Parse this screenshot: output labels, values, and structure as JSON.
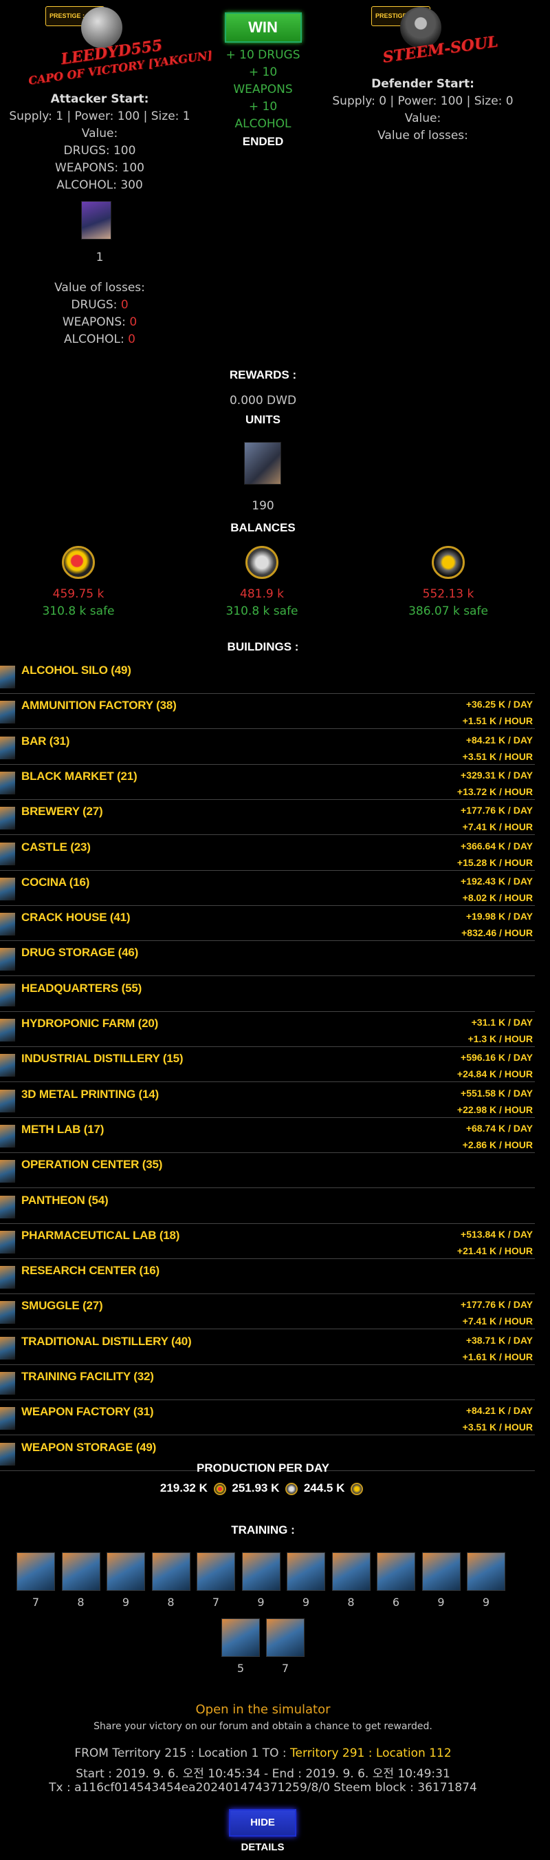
{
  "attacker": {
    "prestige": "PRESTIGE : 1000",
    "name": "LEEDYD555",
    "title": "CAPO OF VICTORY [YAKGUN]",
    "start_heading": "Attacker Start:",
    "stats": "Supply: 1 | Power: 100 | Size: 1",
    "value_label": "Value:",
    "drugs": "DRUGS: 100",
    "weapons": "WEAPONS: 100",
    "alcohol": "ALCOHOL: 300",
    "unit_count": "1",
    "losses_label": "Value of losses:",
    "loss_drugs_label": "DRUGS: ",
    "loss_drugs": "0",
    "loss_weapons_label": "WEAPONS: ",
    "loss_weapons": "0",
    "loss_alcohol_label": "ALCOHOL: ",
    "loss_alcohol": "0"
  },
  "result": {
    "win_label": "WIN",
    "gain_drugs": "+ 10 DRUGS",
    "gain_weapons_1": "+ 10",
    "gain_weapons_2": "WEAPONS",
    "gain_alcohol_1": "+ 10",
    "gain_alcohol_2": "ALCOHOL",
    "status": "ENDED"
  },
  "defender": {
    "prestige": "PRESTIGE : 1000",
    "name": "STEEM-SOUL",
    "start_heading": "Defender Start:",
    "stats": "Supply: 0 | Power: 100 | Size: 0",
    "value_label": "Value:",
    "losses_label": "Value of losses:"
  },
  "rewards": {
    "title": "REWARDS :",
    "amount": "0.000 DWD",
    "units_title": "UNITS",
    "unit_count": "190"
  },
  "balances": {
    "title": "BALANCES",
    "items": [
      {
        "icon": "drugs-icon",
        "value": "459.75 k",
        "safe": "310.8 k safe"
      },
      {
        "icon": "weapons-icon",
        "value": "481.9 k",
        "safe": "310.8 k safe"
      },
      {
        "icon": "alcohol-icon",
        "value": "552.13 k",
        "safe": "386.07 k safe"
      }
    ]
  },
  "buildings": {
    "title": "BUILDINGS :",
    "rows": [
      {
        "name": "ALCOHOL SILO (49)",
        "day": "",
        "hour": ""
      },
      {
        "name": "AMMUNITION FACTORY (38)",
        "day": "+36.25 K / DAY",
        "hour": "+1.51 K / HOUR"
      },
      {
        "name": "BAR (31)",
        "day": "+84.21 K / DAY",
        "hour": "+3.51 K / HOUR"
      },
      {
        "name": "BLACK MARKET (21)",
        "day": "+329.31 K / DAY",
        "hour": "+13.72 K / HOUR"
      },
      {
        "name": "BREWERY (27)",
        "day": "+177.76 K / DAY",
        "hour": "+7.41 K / HOUR"
      },
      {
        "name": "CASTLE (23)",
        "day": "+366.64 K / DAY",
        "hour": "+15.28 K / HOUR"
      },
      {
        "name": "COCINA (16)",
        "day": "+192.43 K / DAY",
        "hour": "+8.02 K / HOUR"
      },
      {
        "name": "CRACK HOUSE (41)",
        "day": "+19.98 K / DAY",
        "hour": "+832.46 / HOUR"
      },
      {
        "name": "DRUG STORAGE (46)",
        "day": "",
        "hour": ""
      },
      {
        "name": "HEADQUARTERS (55)",
        "day": "",
        "hour": ""
      },
      {
        "name": "HYDROPONIC FARM (20)",
        "day": "+31.1 K / DAY",
        "hour": "+1.3 K / HOUR"
      },
      {
        "name": "INDUSTRIAL DISTILLERY (15)",
        "day": "+596.16 K / DAY",
        "hour": "+24.84 K / HOUR"
      },
      {
        "name": "3D METAL PRINTING (14)",
        "day": "+551.58 K / DAY",
        "hour": "+22.98 K / HOUR"
      },
      {
        "name": "METH LAB (17)",
        "day": "+68.74 K / DAY",
        "hour": "+2.86 K / HOUR"
      },
      {
        "name": "OPERATION CENTER (35)",
        "day": "",
        "hour": ""
      },
      {
        "name": "PANTHEON (54)",
        "day": "",
        "hour": ""
      },
      {
        "name": "PHARMACEUTICAL LAB (18)",
        "day": "+513.84 K / DAY",
        "hour": "+21.41 K / HOUR"
      },
      {
        "name": "RESEARCH CENTER (16)",
        "day": "",
        "hour": ""
      },
      {
        "name": "SMUGGLE (27)",
        "day": "+177.76 K / DAY",
        "hour": "+7.41 K / HOUR"
      },
      {
        "name": "TRADITIONAL DISTILLERY (40)",
        "day": "+38.71 K / DAY",
        "hour": "+1.61 K / HOUR"
      },
      {
        "name": "TRAINING FACILITY (32)",
        "day": "",
        "hour": ""
      },
      {
        "name": "WEAPON FACTORY (31)",
        "day": "+84.21 K / DAY",
        "hour": "+3.51 K / HOUR"
      },
      {
        "name": "WEAPON STORAGE (49)",
        "day": "",
        "hour": ""
      }
    ]
  },
  "production": {
    "title": "PRODUCTION PER DAY",
    "drugs": "219.32 K",
    "weapons": "251.93 K",
    "alcohol": "244.5 K"
  },
  "training": {
    "title": "TRAINING :",
    "levels": [
      "7",
      "8",
      "9",
      "8",
      "7",
      "9",
      "9",
      "8",
      "6",
      "9",
      "9",
      "5",
      "7"
    ]
  },
  "footer": {
    "simulator_link": "Open in the simulator",
    "share_text": "Share your victory on our forum and obtain a chance to get rewarded.",
    "from_text": "FROM Territory 215 : Location 1 TO : ",
    "to_text": "Territory 291 : Location 112",
    "time_text": "Start : 2019. 9. 6. 오전 10:45:34 - End : 2019. 9. 6. 오전 10:49:31",
    "tx_text": "Tx : a116cf014543454ea202401474371259/8/0 Steem block : 36171874",
    "hide_button": "HIDE DETAILS"
  },
  "colors": {
    "background": "#000000",
    "accent_yellow": "#ffd024",
    "win_green": "#3cb043",
    "loss_red": "#dd3333",
    "link_orange": "#e6a31e",
    "button_blue": "#1a2aa6"
  }
}
